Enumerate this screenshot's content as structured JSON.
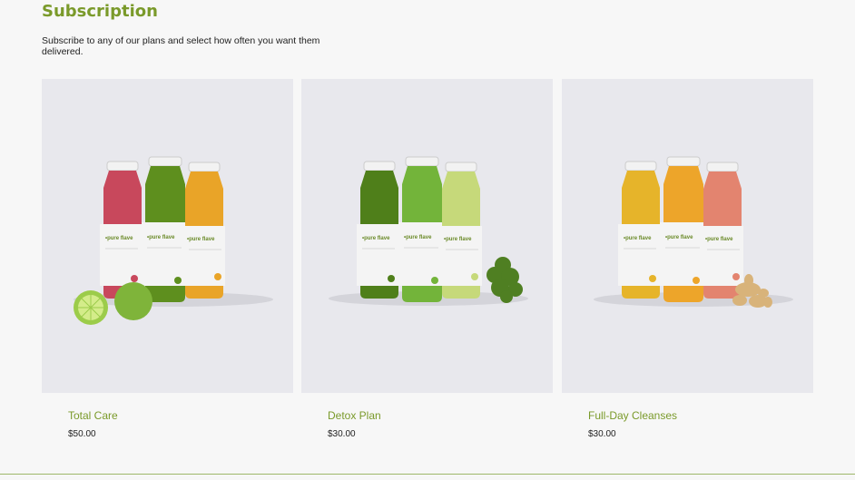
{
  "header": {
    "title": "Subscription",
    "subtitle": "Subscribe to any of our plans and select how often you want them delivered."
  },
  "colors": {
    "accent": "#7a9a2a",
    "card_background": "#e8e8ed",
    "page_background": "#f7f7f7"
  },
  "plans": [
    {
      "name": "Total Care",
      "price": "$50.00",
      "brand_label": "pure flave",
      "juice_colors": [
        "#c8485c",
        "#5e8f1e",
        "#e9a428"
      ],
      "garnish": "lime"
    },
    {
      "name": "Detox Plan",
      "price": "$30.00",
      "brand_label": "pure flave",
      "juice_colors": [
        "#4f7f1a",
        "#73b43a",
        "#c6d97a"
      ],
      "garnish": "parsley"
    },
    {
      "name": "Full-Day Cleanses",
      "price": "$30.00",
      "brand_label": "pure flave",
      "juice_colors": [
        "#e6b42a",
        "#eda52a",
        "#e3846f"
      ],
      "garnish": "ginger"
    }
  ]
}
